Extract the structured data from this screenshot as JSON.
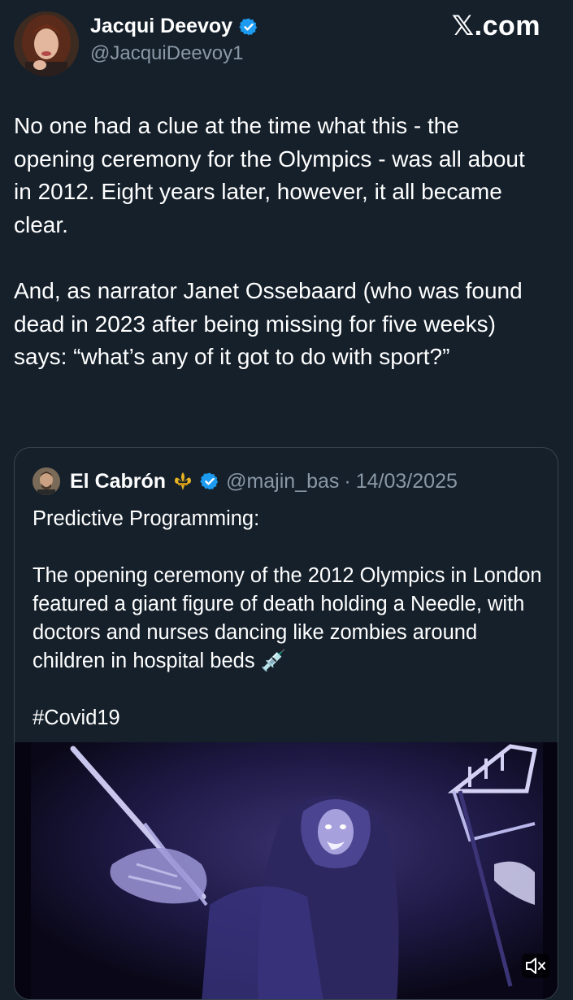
{
  "author": {
    "name": "Jacqui Deevoy",
    "handle": "@JacquiDeevoy1",
    "verified": true
  },
  "brand": "𝕏.com",
  "tweet": {
    "paragraphs": [
      "No one had a clue at the time what this - the opening ceremony for the Olympics - was all about in 2012. Eight years later, however, it all became clear.",
      "And, as narrator Janet Ossebaard (who was found dead in 2023 after being missing for five weeks) says: “what’s any of it got to do with sport?”"
    ]
  },
  "quote": {
    "name": "El Cabrón",
    "emoji": "⚜️",
    "handle": "@majin_bas",
    "separator": "·",
    "date": "14/03/2025",
    "paragraphs": [
      "Predictive Programming:",
      "The opening ceremony of the  2012 Olympics in London featured a giant figure of death holding a Needle, with doctors and nurses dancing like zombies around children in hospital beds 💉",
      "#Covid19"
    ],
    "media": {
      "type": "video",
      "muted": true
    }
  },
  "colors": {
    "background": "#15202b",
    "text": "#ffffff",
    "secondary_text": "#8b98a5",
    "verified_badge": "#1d9bf0",
    "border": "#38444d"
  },
  "icons": [
    "verified-badge-icon",
    "fleur-de-lis-icon",
    "mute-icon"
  ]
}
